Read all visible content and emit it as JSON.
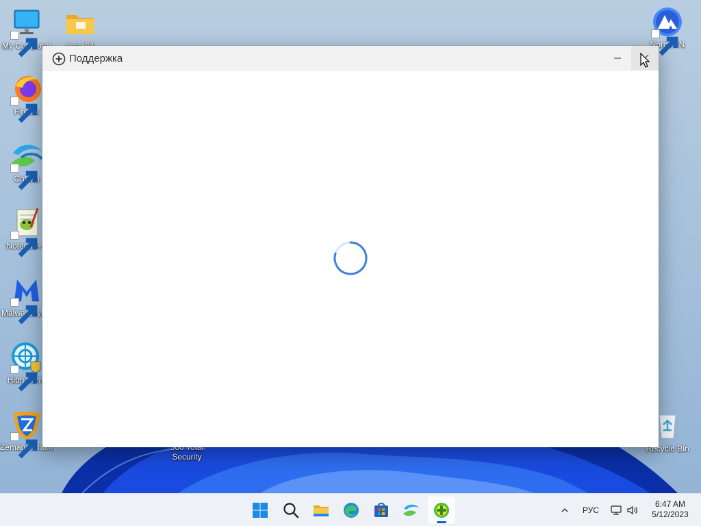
{
  "desktop": {
    "icons": [
      {
        "label": "My Computer",
        "icon": "monitor-icon"
      },
      {
        "label": "ccs-x64",
        "icon": "folder-icon"
      },
      {
        "label": "Firefox",
        "icon": "firefox-icon"
      },
      {
        "label": "Catsxp",
        "icon": "catsxp-icon"
      },
      {
        "label": "Notepad++",
        "icon": "notepad-plus-plus-icon"
      },
      {
        "label": "Malwarebytes",
        "icon": "malwarebytes-icon"
      },
      {
        "label": "HitmanPro",
        "icon": "hitmanpro-icon"
      },
      {
        "label": "Zemana AntiMalware",
        "icon": "zemana-icon"
      },
      {
        "label": "360 Total Security",
        "icon": "360-total-security-icon"
      },
      {
        "label": "NordVPN",
        "icon": "nordvpn-icon"
      },
      {
        "label": "Recycle Bin",
        "icon": "recycle-bin-icon"
      }
    ]
  },
  "window": {
    "title": "Поддержка",
    "title_icon": "plus-circle-icon",
    "state": "loading",
    "controls": {
      "minimize": "minimize-icon",
      "close": "close-icon"
    }
  },
  "taskbar": {
    "apps": [
      {
        "name": "Start",
        "icon": "windows-start-icon"
      },
      {
        "name": "Search",
        "icon": "search-icon"
      },
      {
        "name": "File Explorer",
        "icon": "file-explorer-icon"
      },
      {
        "name": "Microsoft Edge",
        "icon": "edge-icon"
      },
      {
        "name": "Microsoft Store",
        "icon": "store-icon"
      },
      {
        "name": "Catsxp",
        "icon": "catsxp-icon"
      },
      {
        "name": "360 Total Security",
        "icon": "360-total-security-icon",
        "active": true
      }
    ],
    "tray": {
      "chevron_icon": "chevron-up-icon",
      "language": "РУС",
      "network_icon": "network-icon",
      "volume_icon": "volume-icon"
    },
    "clock": {
      "time": "6:47 AM",
      "date": "5/12/2023"
    }
  },
  "colors": {
    "accent": "#0067c0",
    "spinner": "#3b82d6",
    "wallpaper_blue": "#0a3ec8",
    "titlebar_bg": "#f2f2f2",
    "taskbar_bg": "#eef1f5"
  }
}
